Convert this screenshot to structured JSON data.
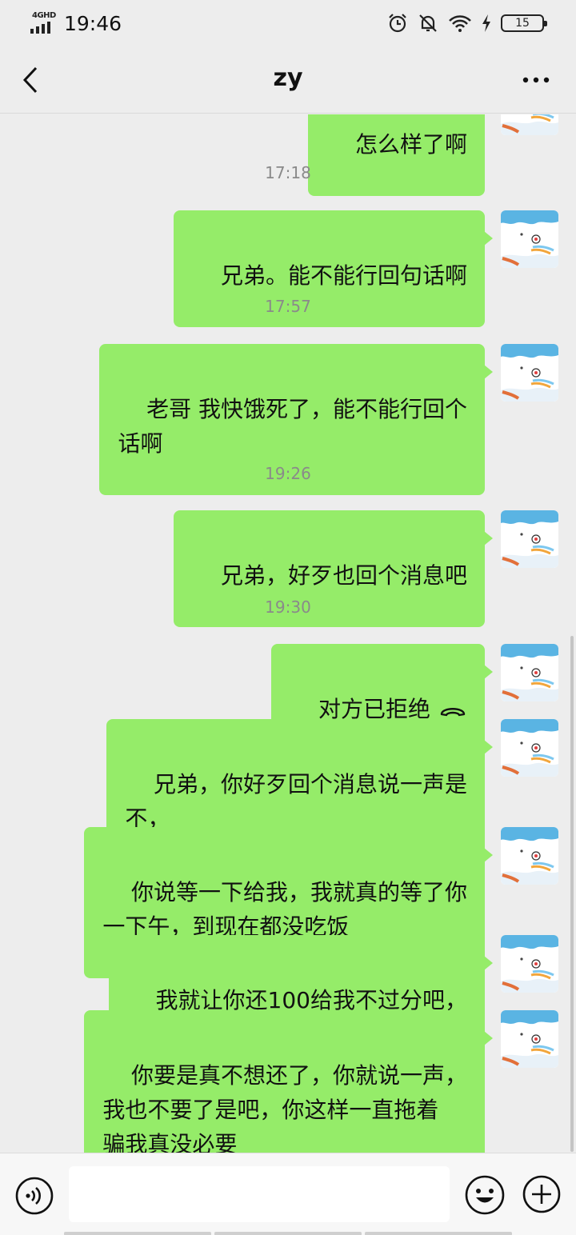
{
  "status_bar": {
    "network": "4GHD",
    "time": "19:46",
    "battery": "15"
  },
  "header": {
    "title": "zy"
  },
  "chat": {
    "timestamps": [
      "17:18",
      "17:57",
      "19:26",
      "19:30"
    ],
    "messages": [
      {
        "text": "怎么样了啊"
      },
      {
        "text": "兄弟。能不能行回句话啊"
      },
      {
        "text": "老哥 我快饿死了，能不能行回个\n话啊"
      },
      {
        "text": "兄弟，好歹也回个消息吧"
      },
      {
        "text": "对方已拒绝",
        "icon": "declined-call-icon"
      },
      {
        "text": "兄弟，你好歹回个消息说一声是\n不，"
      },
      {
        "text": "你说等一下给我，我就真的等了你\n一下午，到现在都没吃饭"
      },
      {
        "text": "我就让你还100给我不过分吧，"
      },
      {
        "text": "你要是真不想还了，你就说一声，\n我也不要了是吧，你这样一直拖着\n骗我真没必要"
      }
    ]
  },
  "input_bar": {
    "message_value": ""
  },
  "colors": {
    "background": "#ededed",
    "bubble_self": "#95ec69",
    "timestamp": "#8a8a8a"
  }
}
